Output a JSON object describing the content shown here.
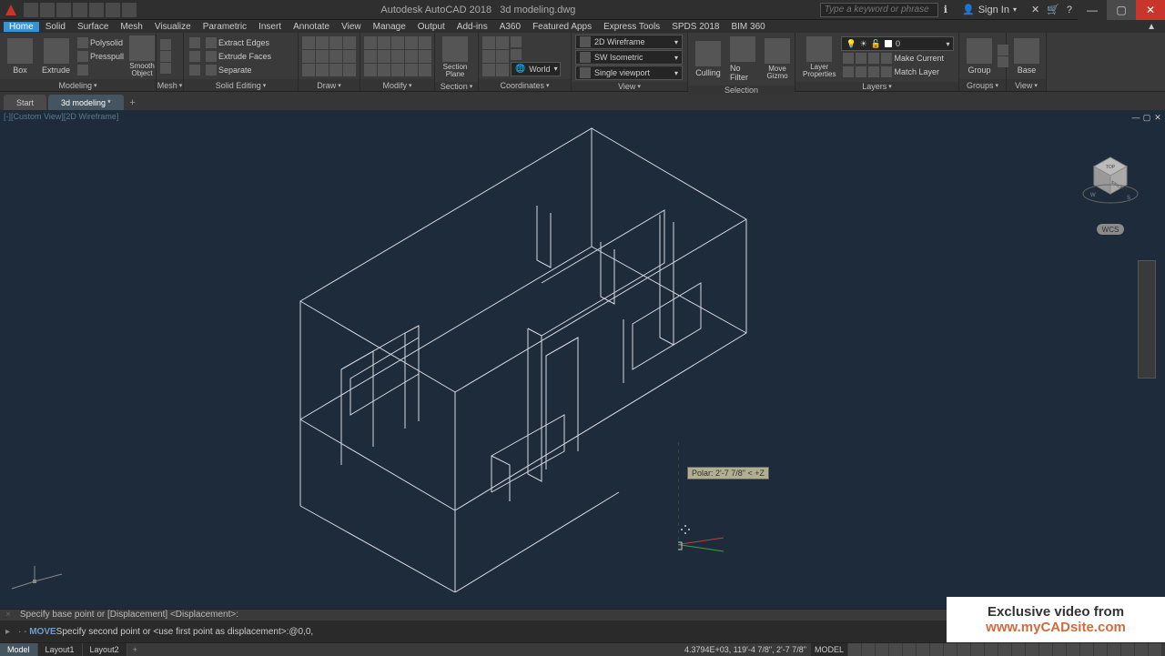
{
  "titlebar": {
    "app_name": "Autodesk AutoCAD 2018",
    "file_name": "3d modeling.dwg",
    "search_placeholder": "Type a keyword or phrase",
    "signin": "Sign In"
  },
  "menubar": {
    "items": [
      "Home",
      "Solid",
      "Surface",
      "Mesh",
      "Visualize",
      "Parametric",
      "Insert",
      "Annotate",
      "View",
      "Manage",
      "Output",
      "Add-ins",
      "A360",
      "Featured Apps",
      "Express Tools",
      "SPDS 2018",
      "BIM 360"
    ]
  },
  "ribbon": {
    "panels": [
      {
        "label": "Modeling",
        "big": [
          {
            "lbl": "Box"
          },
          {
            "lbl": "Extrude"
          }
        ],
        "smallcol": [
          "Polysolid",
          "Presspull",
          ""
        ],
        "obj": "Smooth Object"
      },
      {
        "label": "Mesh"
      },
      {
        "label": "Solid Editing",
        "smallcol": [
          "Extract Edges",
          "Extrude Faces",
          "Separate"
        ]
      },
      {
        "label": "Draw"
      },
      {
        "label": "Modify"
      },
      {
        "label": "Section",
        "big": [
          {
            "lbl": "Section Plane"
          }
        ]
      },
      {
        "label": "Coordinates"
      },
      {
        "label": "View",
        "drops": [
          "2D Wireframe",
          "SW Isometric",
          "Single viewport"
        ]
      },
      {
        "label": "Selection",
        "big": [
          {
            "lbl": "Culling"
          },
          {
            "lbl": "No Filter"
          },
          {
            "lbl": "Move Gizmo"
          }
        ]
      },
      {
        "label": "Layers",
        "big": [
          {
            "lbl": "Layer Properties"
          }
        ],
        "smallcol": [
          "Make Current",
          "Match Layer"
        ],
        "layer_current": "0"
      },
      {
        "label": "Groups",
        "big": [
          {
            "lbl": "Group"
          }
        ]
      },
      {
        "label": "View",
        "big": [
          {
            "lbl": "Base"
          }
        ]
      }
    ],
    "world_coord": "World"
  },
  "doc_tabs": {
    "items": [
      {
        "label": "Start",
        "active": false,
        "dirty": false
      },
      {
        "label": "3d modeling",
        "active": true,
        "dirty": true
      }
    ]
  },
  "viewport": {
    "label": "[-][Custom View][2D Wireframe]",
    "wcs": "WCS",
    "tooltip": "Polar: 2'-7 7/8\" < +Z"
  },
  "cmdline": {
    "hist": "Specify base point or [Displacement] <Displacement>:",
    "prompt": "MOVE Specify second point or <use first point as displacement>:",
    "input": "@0,0,"
  },
  "statusbar": {
    "tabs": [
      "Model",
      "Layout1",
      "Layout2"
    ],
    "coords": "4.3794E+03, 119'-4 7/8\", 2'-7 7/8\"",
    "model": "MODEL"
  },
  "watermark": {
    "line1": "Exclusive video from",
    "line2": "www.myCADsite.com"
  }
}
